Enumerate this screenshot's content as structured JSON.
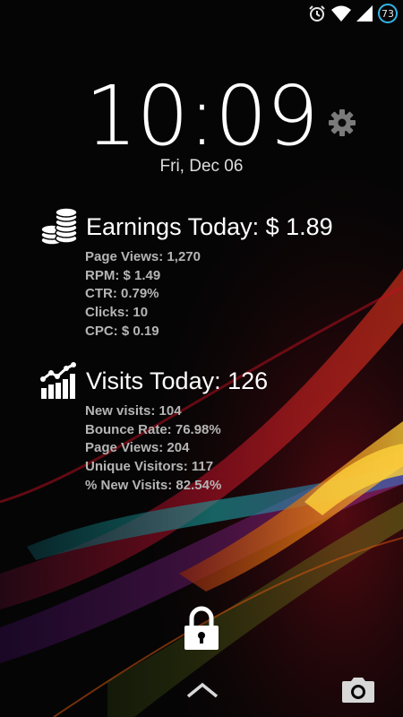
{
  "status_bar": {
    "icons": [
      "alarm-icon",
      "wifi-icon",
      "signal-icon"
    ],
    "battery_level": "73",
    "battery_color": "#33b5e5"
  },
  "lockscreen": {
    "time": "10:09",
    "date": "Fri, Dec 06"
  },
  "earnings": {
    "icon": "coins-stack-icon",
    "title": "Earnings Today: $ 1.89",
    "stats": [
      "Page Views: 1,270",
      "RPM: $ 1.49",
      "CTR: 0.79%",
      "Clicks: 10",
      "CPC: $ 0.19"
    ]
  },
  "visits": {
    "icon": "bar-chart-trend-icon",
    "title": "Visits Today: 126",
    "stats": [
      "New visits: 104",
      "Bounce Rate: 76.98%",
      "Page Views: 204",
      "Unique Visitors: 117",
      "% New Visits: 82.54%"
    ]
  },
  "controls": {
    "settings_icon": "gear-icon",
    "unlock_icon": "padlock-icon",
    "swipe_icon": "chevron-up-icon",
    "camera_icon": "camera-icon"
  }
}
